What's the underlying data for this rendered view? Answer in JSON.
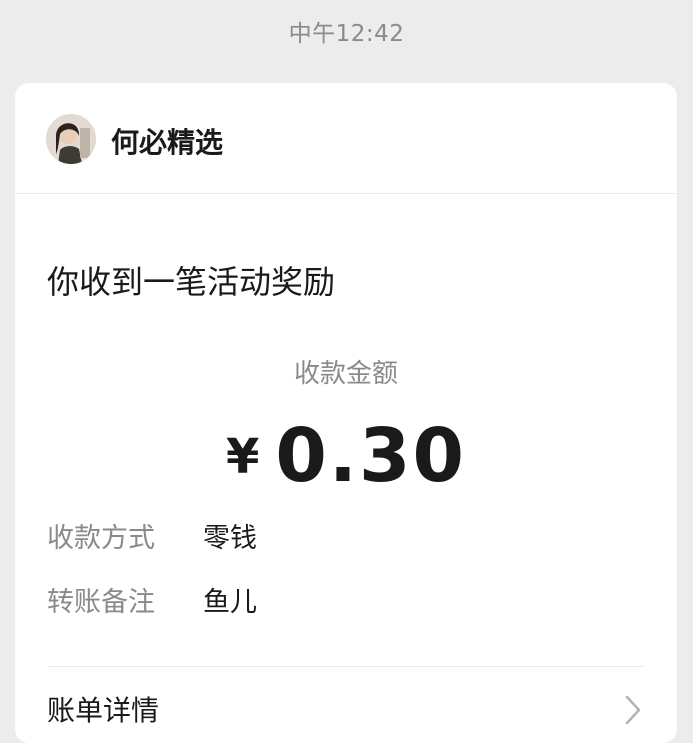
{
  "timestamp": "中午12:42",
  "message_card": {
    "sender": {
      "name": "何必精选",
      "avatar_icon": "avatar-photo"
    },
    "title": "你收到一笔活动奖励",
    "amount": {
      "label": "收款金额",
      "currency_symbol": "¥",
      "value": "0.30"
    },
    "details": [
      {
        "label": "收款方式",
        "value": "零钱"
      },
      {
        "label": "转账备注",
        "value": "鱼儿"
      }
    ],
    "footer": {
      "label": "账单详情",
      "icon": "chevron-right-icon"
    }
  },
  "colors": {
    "background": "#ececec",
    "card": "#ffffff",
    "primary_text": "#1a1a1a",
    "secondary_text": "#8a8a8a"
  }
}
